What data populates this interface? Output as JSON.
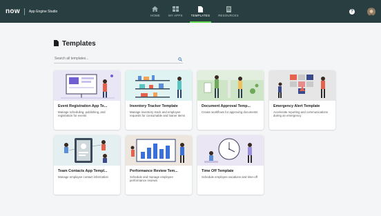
{
  "header": {
    "logo": "now",
    "app_name": "App Engine Studio",
    "nav": [
      {
        "label": "HOME",
        "icon": "home-icon"
      },
      {
        "label": "MY APPS",
        "icon": "grid-icon"
      },
      {
        "label": "TEMPLATES",
        "icon": "document-icon",
        "active": true
      },
      {
        "label": "RESOURCES",
        "icon": "book-icon"
      }
    ],
    "help_label": "?",
    "colors": {
      "bar": "#293e40",
      "active_underline": "#62d84e"
    }
  },
  "page": {
    "title": "Templates",
    "search_placeholder": "Search all templates..."
  },
  "templates": [
    {
      "title": "Event Registration App Te...",
      "description": "Manage scheduling, publishing, and registration for events",
      "thumb_color": "#e9e6f5"
    },
    {
      "title": "Inventory Tracker Template",
      "description": "Manage inventory stock and employee requests for consumable and loaner items",
      "thumb_color": "#dff3f3"
    },
    {
      "title": "Document Approval Temp...",
      "description": "Create workflows for approving documents",
      "thumb_color": "#e2efdf"
    },
    {
      "title": "Emergency Alert Template",
      "description": "Accelerate reporting and communications during an emergency",
      "thumb_color": "#e6e6e6"
    },
    {
      "title": "Team Contacts App Templ...",
      "description": "Manage employee contact information",
      "thumb_color": "#e3eff0"
    },
    {
      "title": "Performance Review Tem...",
      "description": "Schedule and manage employee performance reviews",
      "thumb_color": "#ece6df"
    },
    {
      "title": "Time Off Template",
      "description": "Schedule employee vacations and time-off",
      "thumb_color": "#ebe6f3"
    }
  ]
}
